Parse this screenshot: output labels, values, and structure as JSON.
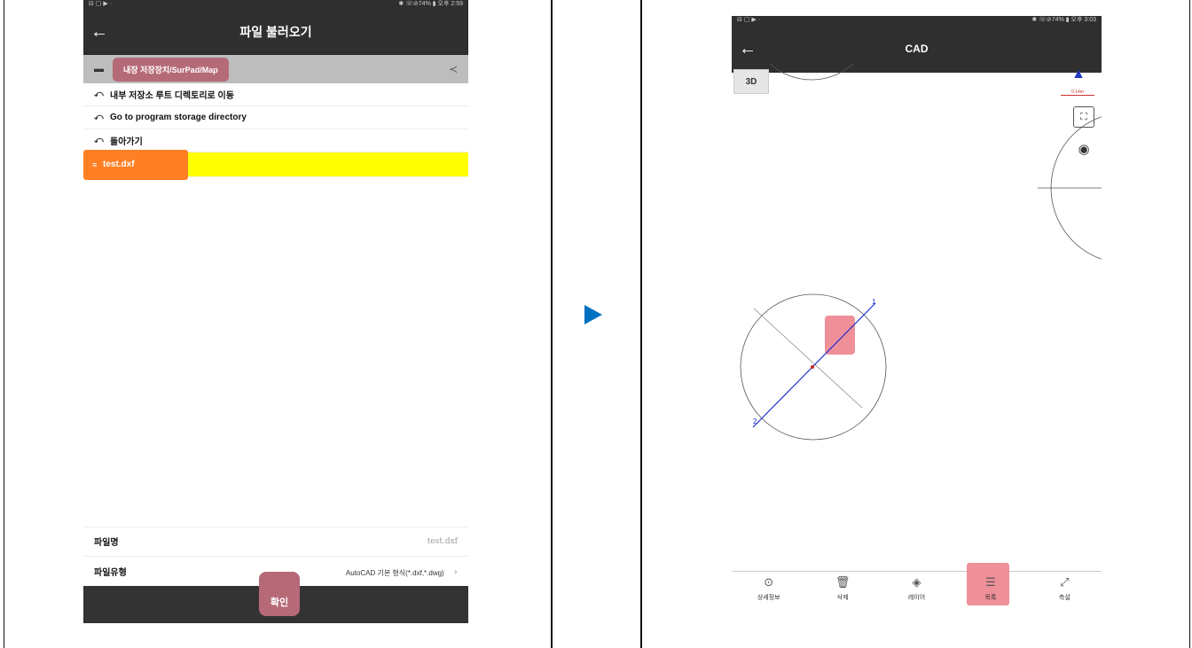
{
  "left": {
    "status": {
      "left_icons": "⊟ ▢ ▶ ·",
      "right_text": "✱ ☏⊘74% ▮ 오후 2:59"
    },
    "title": "파일 불러오기",
    "path": "내장 저장장치/SurPad/Map",
    "rows": [
      {
        "icon": "⤺",
        "label": "내부 저장소 루트 디렉토리로 이동"
      },
      {
        "icon": "⤺",
        "label": "Go to program storage directory"
      },
      {
        "icon": "⤺",
        "label": "돌아가기"
      }
    ],
    "selected_file": {
      "icon": "≡",
      "label": "test.dxf"
    },
    "filename_label": "파일명",
    "filename_value": "test.dxf",
    "filetype_label": "파일유형",
    "filetype_value": "AutoCAD 기본 형식(*.dxf,*.dwg)",
    "filetype_chevron": "›",
    "confirm_label": "확인"
  },
  "right": {
    "status": {
      "left_icons": "⊟ ▢ ▶ ·",
      "right_text": "✱ ☏⊘74% ▮ 오후 3:03"
    },
    "title": "CAD",
    "btn_3d": "3D",
    "scale": "0.14m",
    "point_labels": {
      "p1": "1",
      "p2": "2"
    },
    "nav": [
      {
        "icon": "⊙",
        "label": "상세정보"
      },
      {
        "icon": "🗑",
        "label": "삭제"
      },
      {
        "icon": "◈",
        "label": "레이어"
      },
      {
        "icon": "☰",
        "label": "목록"
      },
      {
        "icon": "⤢",
        "label": "측설"
      }
    ],
    "colors": {
      "line": "#1f2fd0",
      "highlight": "#ef8f98",
      "selected_row": "#ffff00",
      "file_pill": "#ff7f24"
    }
  },
  "back_icon": "←"
}
